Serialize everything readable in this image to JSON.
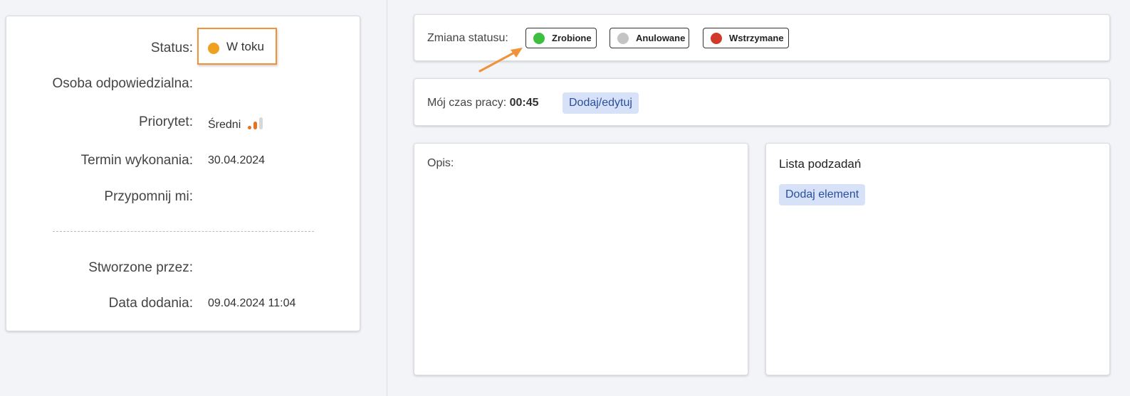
{
  "details": {
    "status_label": "Status:",
    "status_value": "W toku",
    "status_color": "#f0a020",
    "responsible_label": "Osoba odpowiedzialna:",
    "responsible_value": "",
    "priority_label": "Priorytet:",
    "priority_value": "Średni",
    "priority_level": 2,
    "priority_max": 3,
    "priority_color": "#e8731d",
    "priority_inactive_color": "#d8d8d8",
    "due_label": "Termin wykonania:",
    "due_value": "30.04.2024",
    "remind_label": "Przypomnij mi:",
    "remind_value": "",
    "created_by_label": "Stworzone przez:",
    "created_by_value": "",
    "added_label": "Data dodania:",
    "added_value": "09.04.2024 11:04"
  },
  "status_change": {
    "title": "Zmiana statusu:",
    "buttons": [
      {
        "label": "Zrobione",
        "color": "#3fbf3f"
      },
      {
        "label": "Anulowane",
        "color": "#c4c4c4"
      },
      {
        "label": "Wstrzymane",
        "color": "#d03a2b"
      }
    ]
  },
  "worktime": {
    "label": "Mój czas pracy:",
    "value": "00:45",
    "edit_button": "Dodaj/edytuj"
  },
  "description": {
    "title": "Opis:"
  },
  "subtasks": {
    "title": "Lista podzadań",
    "add_button": "Dodaj element"
  },
  "annotation": {
    "arrow_color": "#f0923a",
    "highlight_color": "#f0923a"
  }
}
